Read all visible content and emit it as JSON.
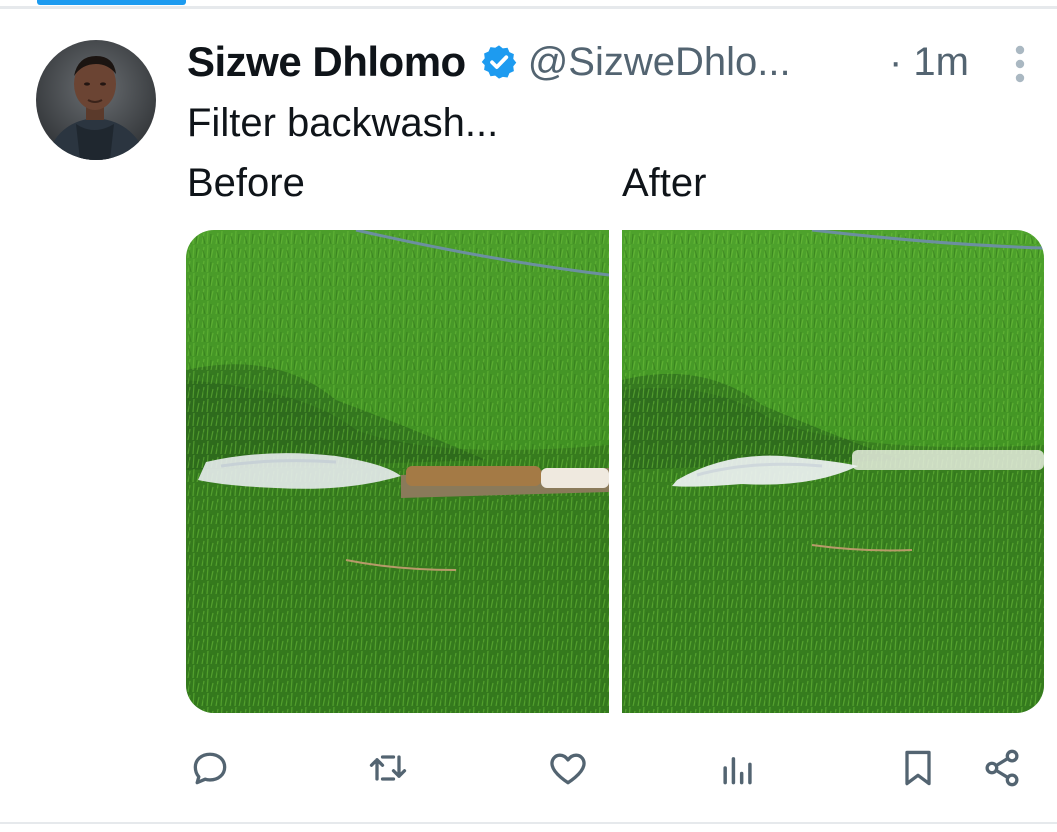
{
  "post": {
    "author_name": "Sizwe Dhlomo",
    "author_handle": "@SizweDhlo...",
    "timestamp": "· 1m",
    "verified": true,
    "text": "Filter backwash...",
    "before_label": "Before",
    "after_label": "After"
  },
  "icons": {
    "verified": "verified-badge-icon",
    "more": "more-vertical-icon",
    "reply": "reply-icon",
    "repost": "repost-icon",
    "like": "like-icon",
    "views": "views-icon",
    "bookmark": "bookmark-icon",
    "share": "share-icon"
  },
  "colors": {
    "accent": "#1d9bf0",
    "secondary_text": "#536471",
    "primary_text": "#0f1419",
    "grass": "#3e9a24"
  }
}
